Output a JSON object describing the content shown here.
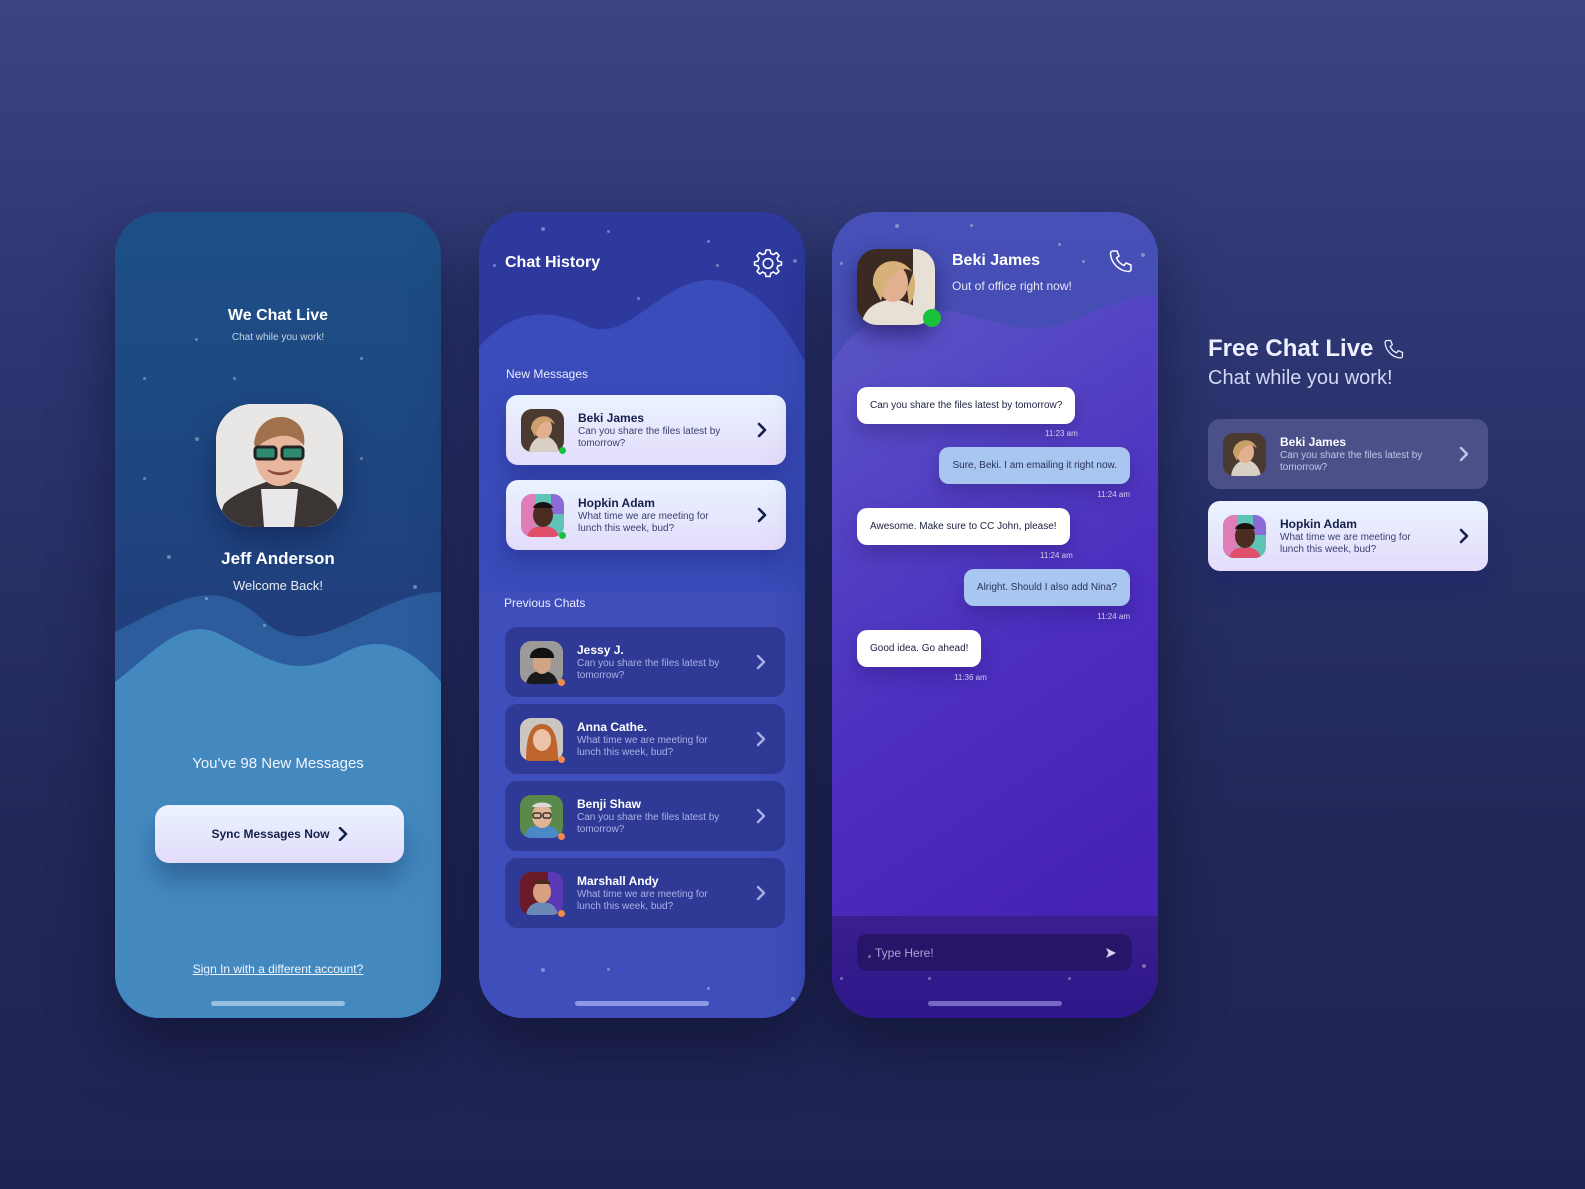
{
  "colors": {
    "online": "#18c23a",
    "away": "#f08a4b",
    "bubble_in": "#ffffff",
    "bubble_out": "#a8c6ef",
    "accent_dark": "#14204a"
  },
  "login_screen": {
    "app_title": "We Chat Live",
    "app_subtitle": "Chat while you work!",
    "user_name": "Jeff Anderson",
    "welcome_text": "Welcome Back!",
    "new_messages_text": "You've 98 New Messages",
    "sync_button_label": "Sync Messages Now",
    "sign_in_link": "Sign In with a different account?"
  },
  "history_screen": {
    "title": "Chat History",
    "settings_icon": "gear-icon",
    "new_messages_label": "New Messages",
    "new_messages": [
      {
        "name": "Beki James",
        "message": "Can you share the files latest by tomorrow?",
        "status": "online"
      },
      {
        "name": "Hopkin Adam",
        "message": "What time we are meeting for lunch this week, bud?",
        "status": "online"
      }
    ],
    "previous_chats_label": "Previous Chats",
    "previous_chats": [
      {
        "name": "Jessy J.",
        "message": "Can you share the files latest by tomorrow?",
        "status": "away"
      },
      {
        "name": "Anna Cathe.",
        "message": "What time we are meeting for lunch this week, bud?",
        "status": "away"
      },
      {
        "name": "Benji Shaw",
        "message": "Can you share the files latest by tomorrow?",
        "status": "away"
      },
      {
        "name": "Marshall Andy",
        "message": "What time we are meeting for lunch this week, bud?",
        "status": "away"
      }
    ]
  },
  "chat_screen": {
    "contact_name": "Beki James",
    "contact_status": "Out of office right now!",
    "call_icon": "phone-icon",
    "messages": [
      {
        "direction": "in",
        "text": "Can you share the files latest by tomorrow?",
        "time": "11:23 am"
      },
      {
        "direction": "out",
        "text": "Sure, Beki. I am emailing it right now.",
        "time": "11:24 am"
      },
      {
        "direction": "in",
        "text": "Awesome. Make sure to CC John, please!",
        "time": "11:24 am"
      },
      {
        "direction": "out",
        "text": "Alright. Should I also add Nina?",
        "time": "11:24 am"
      },
      {
        "direction": "in",
        "text": "Good idea. Go ahead!",
        "time": "11:36 am"
      }
    ],
    "composer_placeholder": "Type Here!",
    "send_icon": "send-icon"
  },
  "promo": {
    "title": "Free Chat Live",
    "subtitle": "Chat while you work!",
    "cards": [
      {
        "name": "Beki James",
        "message": "Can you share the files latest by tomorrow?"
      },
      {
        "name": "Hopkin Adam",
        "message": "What time we are meeting for lunch this week, bud?"
      }
    ]
  }
}
